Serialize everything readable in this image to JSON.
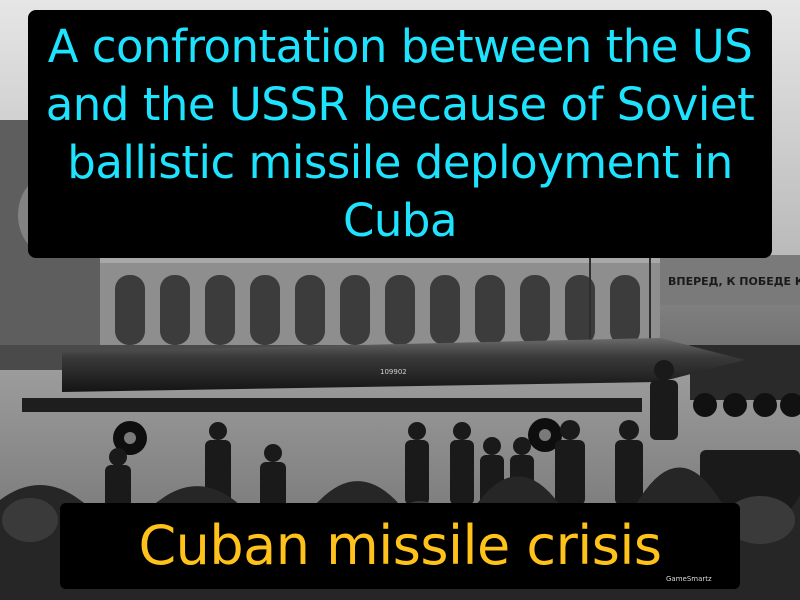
{
  "definition": "A confrontation between the US and the USSR because of Soviet ballistic missile deployment in Cuba",
  "term": "Cuban missile crisis",
  "watermark": "GameSmartz",
  "photo": {
    "banner_text": "ВПЕРЕД, К ПОБЕДЕ КО",
    "missile_serial": "109902"
  },
  "colors": {
    "definition_text": "#1ee3ff",
    "term_text": "#ffc21a",
    "box_background": "#000000"
  }
}
